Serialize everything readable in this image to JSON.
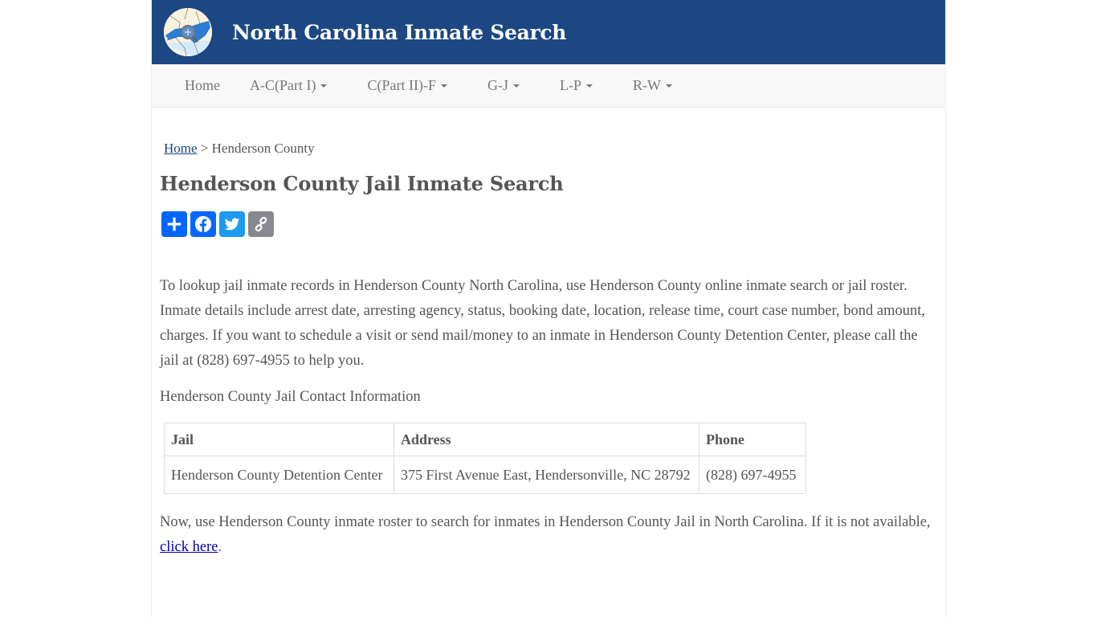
{
  "header": {
    "site_title": "North Carolina Inmate Search",
    "logo_icon": "nc-map-search-logo",
    "bg_color": "#1c4782"
  },
  "nav": {
    "items": [
      {
        "label": "Home",
        "has_dropdown": false
      },
      {
        "label": "A-C(Part I)",
        "has_dropdown": true
      },
      {
        "label": "C(Part II)-F",
        "has_dropdown": true
      },
      {
        "label": "G-J",
        "has_dropdown": true
      },
      {
        "label": "L-P",
        "has_dropdown": true
      },
      {
        "label": "R-W",
        "has_dropdown": true
      }
    ]
  },
  "breadcrumb": {
    "home_label": "Home",
    "separator": " > ",
    "current": "Henderson County"
  },
  "page_title": "Henderson County Jail Inmate Search",
  "share": {
    "buttons": [
      {
        "name": "share",
        "icon": "plus-icon",
        "color": "#0166ff"
      },
      {
        "name": "facebook",
        "icon": "facebook-icon",
        "color": "#0866ff"
      },
      {
        "name": "twitter",
        "icon": "twitter-icon",
        "color": "#1d9bf0"
      },
      {
        "name": "copy-link",
        "icon": "link-icon",
        "color": "#888990"
      }
    ]
  },
  "intro_text": "To lookup jail inmate records in Henderson County North Carolina, use Henderson County online inmate search or jail roster. Inmate details include arrest date, arresting agency, status, booking date, location, release time, court case number, bond amount, charges. If you want to schedule a visit or send mail/money to an inmate in Henderson County Detention Center, please call the jail at (828) 697-4955 to help you.",
  "contact_heading": "Henderson County Jail Contact Information",
  "contact_table": {
    "headers": [
      "Jail",
      "Address",
      "Phone"
    ],
    "rows": [
      [
        "Henderson County Detention Center",
        "375 First Avenue East, Hendersonville, NC 28792",
        "(828) 697-4955"
      ]
    ]
  },
  "closing": {
    "text": "Now, use Henderson County inmate roster to search for inmates in Henderson County Jail in North Carolina. If it is not available, ",
    "link_label": "click here",
    "trailing": "."
  }
}
